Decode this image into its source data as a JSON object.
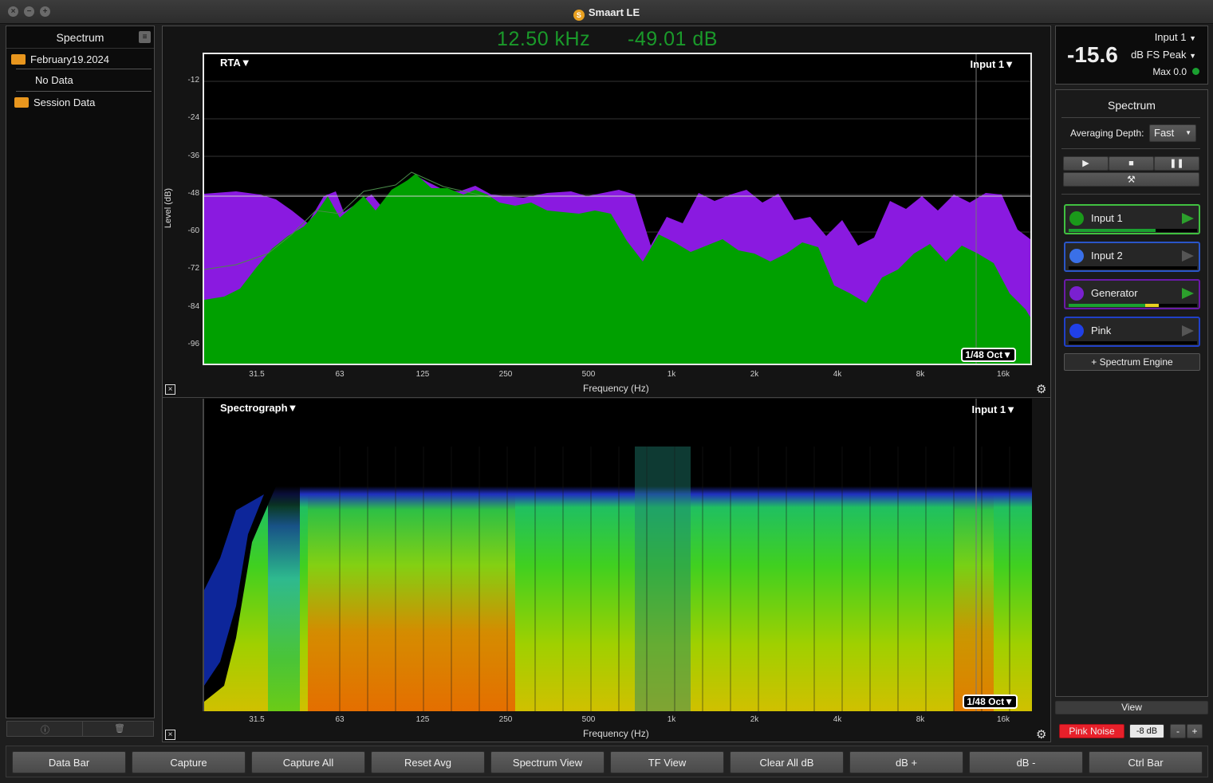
{
  "window": {
    "title": "Smaart LE"
  },
  "data_bar": {
    "title": "Spectrum",
    "items": [
      {
        "label": "February19.2024"
      },
      {
        "label": "No Data"
      },
      {
        "label": "Session Data"
      }
    ]
  },
  "readout": {
    "frequency": "12.50 kHz",
    "level": "-49.01 dB"
  },
  "rta": {
    "plot_type": "RTA▼",
    "input": "Input 1▼",
    "resolution": "1/48 Oct▼",
    "y_axis_title": "Level (dB)",
    "x_axis_title": "Frequency (Hz)",
    "y_ticks": [
      "-12",
      "-24",
      "-36",
      "-48",
      "-60",
      "-72",
      "-84",
      "-96"
    ],
    "x_ticks": [
      "31.5",
      "63",
      "125",
      "250",
      "500",
      "1k",
      "2k",
      "4k",
      "8k",
      "16k"
    ]
  },
  "spectrograph": {
    "plot_type": "Spectrograph▼",
    "input": "Input 1▼",
    "resolution": "1/48 Oct▼",
    "x_axis_title": "Frequency (Hz)",
    "x_ticks": [
      "31.5",
      "63",
      "125",
      "250",
      "500",
      "1k",
      "2k",
      "4k",
      "8k",
      "16k"
    ]
  },
  "level_meter": {
    "input": "Input 1",
    "value": "-15.6",
    "unit": "dB FS Peak",
    "max": "Max 0.0"
  },
  "control_bar": {
    "title": "Spectrum",
    "averaging_label": "Averaging Depth:",
    "averaging_value": "Fast",
    "channels": [
      {
        "name": "Input 1",
        "color": "#1a9a1a",
        "meter_level": 0.68
      },
      {
        "name": "Input 2",
        "color": "#3060e0",
        "meter_level": 0.0
      },
      {
        "name": "Generator",
        "color": "#7a20d0",
        "meter_level": 0.7
      },
      {
        "name": "Pink",
        "color": "#2040e0",
        "meter_level": 0.0
      }
    ],
    "add_engine": "+ Spectrum Engine",
    "view_label": "View",
    "generator_label": "Pink Noise",
    "generator_level": "-8 dB",
    "minus": "-",
    "plus": "+"
  },
  "bottom_bar": {
    "buttons": [
      "Data Bar",
      "Capture",
      "Capture All",
      "Reset Avg",
      "Spectrum View",
      "TF View",
      "Clear All dB",
      "dB +",
      "dB -",
      "Ctrl Bar"
    ]
  },
  "colors": {
    "measurement": "#00a000",
    "reference": "#8a1ae0",
    "readout": "#1a9a2a",
    "generator_button": "#e8202a"
  }
}
